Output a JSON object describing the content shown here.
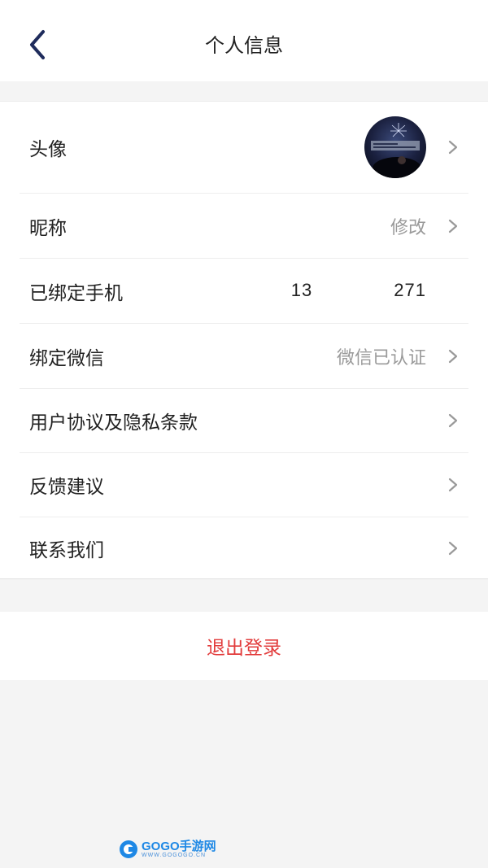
{
  "header": {
    "title": "个人信息",
    "back_icon": "chevron-left-icon"
  },
  "rows": [
    {
      "label": "头像",
      "value": "",
      "type": "avatar"
    },
    {
      "label": "昵称",
      "value": "修改"
    },
    {
      "label": "已绑定手机",
      "value_prefix": "13",
      "value_suffix": "271"
    },
    {
      "label": "绑定微信",
      "value": "微信已认证"
    },
    {
      "label": "用户协议及隐私条款",
      "value": ""
    },
    {
      "label": "反馈建议",
      "value": ""
    },
    {
      "label": "联系我们",
      "value": ""
    }
  ],
  "logout": {
    "label": "退出登录"
  },
  "watermark": {
    "main": "GOGO手游网",
    "sub": "WWW.GOGOGO.CN"
  },
  "colors": {
    "accent_red": "#e23c3c",
    "back_icon": "#1f2c5c",
    "secondary_text": "#9a9a9a",
    "background": "#f4f4f4"
  }
}
